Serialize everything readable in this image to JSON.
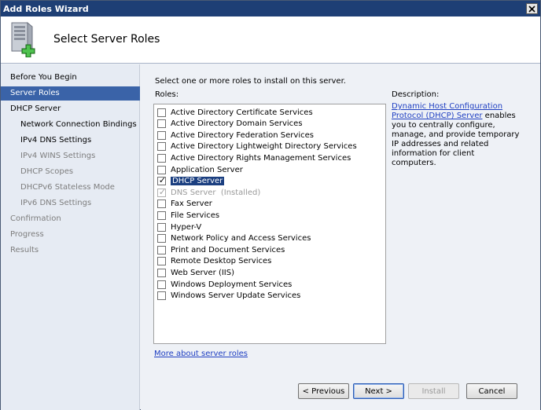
{
  "window": {
    "title": "Add Roles Wizard"
  },
  "header": {
    "title": "Select Server Roles"
  },
  "sidebar": {
    "items": [
      {
        "label": "Before You Begin",
        "state": "normal",
        "level": 0
      },
      {
        "label": "Server Roles",
        "state": "active",
        "level": 0
      },
      {
        "label": "DHCP Server",
        "state": "normal",
        "level": 0
      },
      {
        "label": "Network Connection Bindings",
        "state": "normal",
        "level": 1
      },
      {
        "label": "IPv4 DNS Settings",
        "state": "normal",
        "level": 1
      },
      {
        "label": "IPv4 WINS Settings",
        "state": "grey",
        "level": 1
      },
      {
        "label": "DHCP Scopes",
        "state": "grey",
        "level": 1
      },
      {
        "label": "DHCPv6 Stateless Mode",
        "state": "grey",
        "level": 1
      },
      {
        "label": "IPv6 DNS Settings",
        "state": "grey",
        "level": 1
      },
      {
        "label": "Confirmation",
        "state": "grey",
        "level": 0
      },
      {
        "label": "Progress",
        "state": "grey",
        "level": 0
      },
      {
        "label": "Results",
        "state": "grey",
        "level": 0
      }
    ]
  },
  "main": {
    "instruction": "Select one or more roles to install on this server.",
    "roles_label": "Roles:",
    "roles": [
      {
        "label": "Active Directory Certificate Services",
        "checked": false,
        "disabled": false,
        "selected": false
      },
      {
        "label": "Active Directory Domain Services",
        "checked": false,
        "disabled": false,
        "selected": false
      },
      {
        "label": "Active Directory Federation Services",
        "checked": false,
        "disabled": false,
        "selected": false
      },
      {
        "label": "Active Directory Lightweight Directory Services",
        "checked": false,
        "disabled": false,
        "selected": false
      },
      {
        "label": "Active Directory Rights Management Services",
        "checked": false,
        "disabled": false,
        "selected": false
      },
      {
        "label": "Application Server",
        "checked": false,
        "disabled": false,
        "selected": false
      },
      {
        "label": "DHCP Server",
        "checked": true,
        "disabled": false,
        "selected": true
      },
      {
        "label": "DNS Server  (Installed)",
        "checked": true,
        "disabled": true,
        "selected": false
      },
      {
        "label": "Fax Server",
        "checked": false,
        "disabled": false,
        "selected": false
      },
      {
        "label": "File Services",
        "checked": false,
        "disabled": false,
        "selected": false
      },
      {
        "label": "Hyper-V",
        "checked": false,
        "disabled": false,
        "selected": false
      },
      {
        "label": "Network Policy and Access Services",
        "checked": false,
        "disabled": false,
        "selected": false
      },
      {
        "label": "Print and Document Services",
        "checked": false,
        "disabled": false,
        "selected": false
      },
      {
        "label": "Remote Desktop Services",
        "checked": false,
        "disabled": false,
        "selected": false
      },
      {
        "label": "Web Server (IIS)",
        "checked": false,
        "disabled": false,
        "selected": false
      },
      {
        "label": "Windows Deployment Services",
        "checked": false,
        "disabled": false,
        "selected": false
      },
      {
        "label": "Windows Server Update Services",
        "checked": false,
        "disabled": false,
        "selected": false
      }
    ],
    "description_label": "Description:",
    "description_link": "Dynamic Host Configuration Protocol (DHCP) Server",
    "description_text": " enables you to centrally configure, manage, and provide temporary IP addresses and related information for client computers.",
    "more_link": "More about server roles"
  },
  "buttons": {
    "previous": "< Previous",
    "next": "Next >",
    "install": "Install",
    "cancel": "Cancel"
  },
  "colors": {
    "titlebar": "#1e3f75",
    "sidebar_active": "#3a63a8",
    "link": "#1f3fc2",
    "selection": "#1b3f80"
  },
  "icons": {
    "header": "server-add-icon",
    "close": "close-icon",
    "check": "checkmark-icon"
  }
}
